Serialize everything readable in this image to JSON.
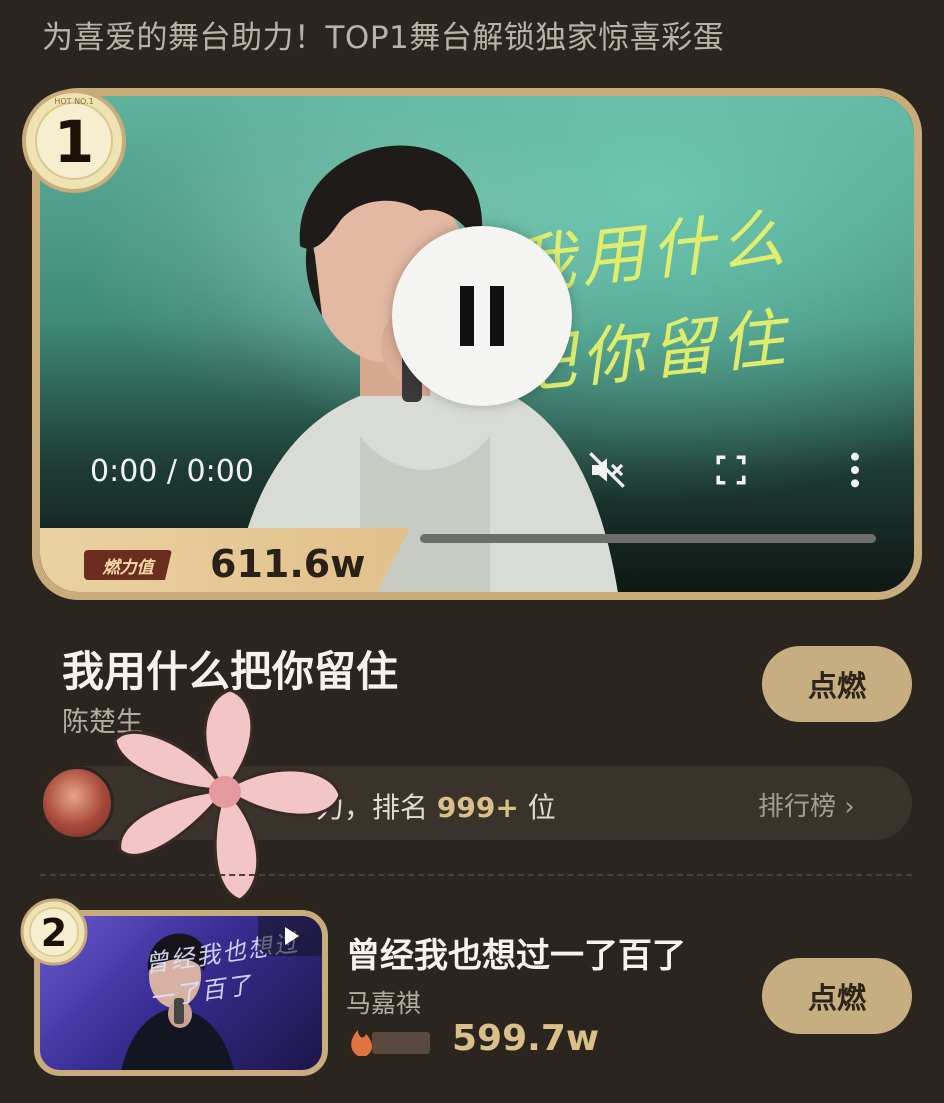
{
  "banner": "为喜爱的舞台助力！TOP1舞台解锁独家惊喜彩蛋",
  "top1": {
    "rank": "1",
    "medal_text": "HOT NO.1",
    "video": {
      "lyric_line1": "我用什么",
      "lyric_line2": "把你留住",
      "time": "0:00 / 0:00",
      "progress": 0,
      "icons": [
        "pause-icon",
        "mute-icon",
        "fullscreen-icon",
        "more-vertical-icon"
      ]
    },
    "fire_label": "燃力值",
    "fire_value": "611.6w",
    "title": "我用什么把你留住",
    "artist": "陈楚生",
    "ignite_label": "点燃",
    "rank_text_prefix": "力，排名",
    "rank_number": "999+",
    "rank_text_suffix": "位",
    "rank_link": "排行榜"
  },
  "top2": {
    "rank": "2",
    "thumb_lyric": "曾经我也想过一了百了",
    "title": "曾经我也想过一了百了",
    "artist": "马嘉祺",
    "fire_value": "599.7w",
    "ignite_label": "点燃"
  },
  "colors": {
    "background": "#2b2520",
    "gold": "#c8ac7b",
    "button": "#c7ae80",
    "accent_text": "#d9c089"
  }
}
